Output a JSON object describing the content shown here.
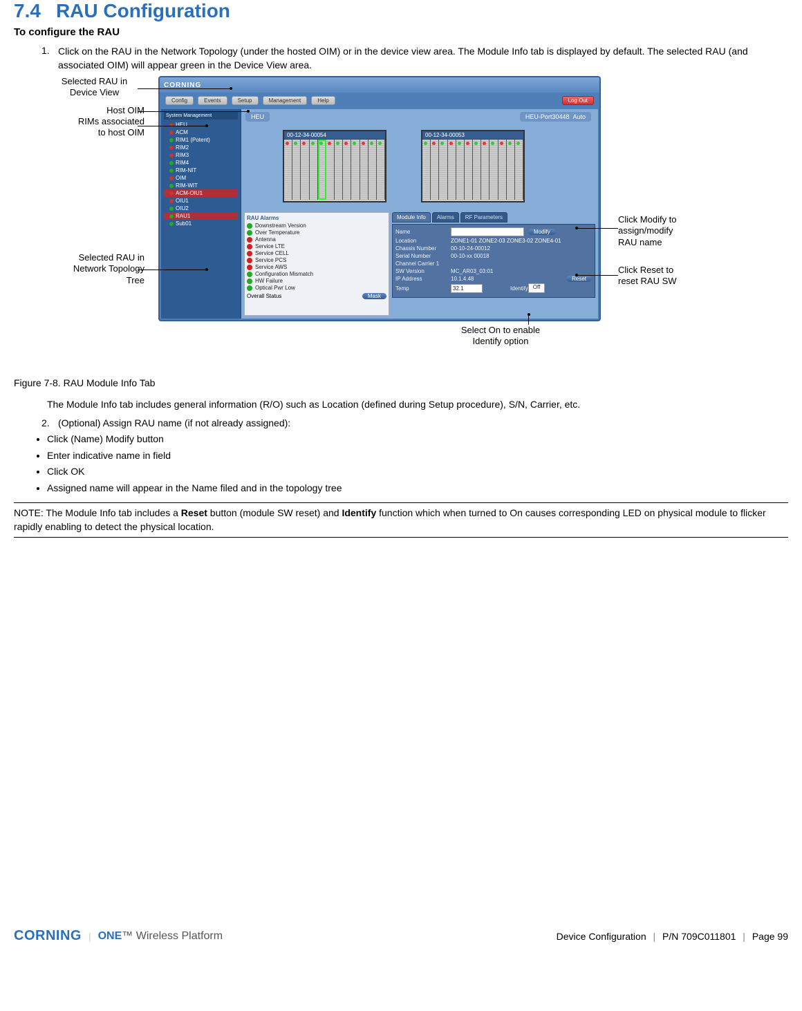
{
  "heading": {
    "number": "7.4",
    "title": "RAU Configuration"
  },
  "subheading": "To configure the RAU",
  "step1_num": "1.",
  "step1": "Click on the RAU in the Network Topology (under the hosted OIM) or in the device view area. The Module Info tab is displayed by default. The selected RAU (and associated OIM) will appear green in the Device View area.",
  "figure_caption": "Figure 7-8. RAU Module Info Tab",
  "module_info_para": "The Module Info tab includes general information (R/O) such as Location (defined during Setup procedure), S/N, Carrier, etc.",
  "step2_num": "2.",
  "step2": "(Optional) Assign RAU name (if not already assigned):",
  "bullets": [
    "Click (Name) Modify button",
    "Enter indicative name in field",
    "Click OK",
    "Assigned name will appear in the Name filed and in the topology tree"
  ],
  "note_prefix": "NOTE: The Module Info tab includes a ",
  "note_reset": "Reset",
  "note_mid": " button (module SW reset) and ",
  "note_identify": "Identify",
  "note_suffix": " function which when turned to On causes corresponding LED on physical module to flicker rapidly enabling to detect the physical location.",
  "callouts": {
    "c1": "Selected RAU in\nDevice View",
    "c2": "Host OIM",
    "c3": "RIMs associated\nto host OIM",
    "c4": "Selected RAU in\nNetwork Topology\nTree",
    "c5": "Click Modify to\nassign/modify\nRAU name",
    "c6": "Click Reset to\nreset RAU SW",
    "c7": "Select On to enable\nIdentify option"
  },
  "screenshot": {
    "brand": "CORNING",
    "toolbar": [
      "Config",
      "Events",
      "Setup",
      "Management",
      "Help"
    ],
    "logout": "Log Out",
    "tree_title": "System Management",
    "tree": [
      {
        "label": "HEU",
        "dot": "r"
      },
      {
        "label": "ACM",
        "dot": "r",
        "sub": false
      },
      {
        "label": "RIM1 (Potent)",
        "dot": "g"
      },
      {
        "label": "RIM2",
        "dot": "r"
      },
      {
        "label": "RIM3",
        "dot": "r"
      },
      {
        "label": "RIM4",
        "dot": "g"
      },
      {
        "label": "RIM-NIT",
        "dot": "g"
      },
      {
        "label": "OIM",
        "dot": "r"
      },
      {
        "label": "RIM-WIT",
        "dot": "g"
      },
      {
        "label": "ACM-OIU1",
        "dot": "r",
        "sel": true
      },
      {
        "label": "OIU1",
        "dot": "r"
      },
      {
        "label": "OIU2",
        "dot": "g"
      },
      {
        "label": "RAU1",
        "dot": "g",
        "sel": true
      },
      {
        "label": "Sub01",
        "dot": "g"
      }
    ],
    "dv_title": "HEU",
    "dv_ip": "HEU-Port30448",
    "dv_auto": "Auto",
    "rack1_label": "00-12-34-00054",
    "rack2_label": "00-12-34-00053",
    "alarms_header": "RAU Alarms",
    "alarms": [
      {
        "c": "g",
        "t": "Downstream Version"
      },
      {
        "c": "g",
        "t": "Over Temperature"
      },
      {
        "c": "r",
        "t": "Antenna"
      },
      {
        "c": "r",
        "t": "Service LTE"
      },
      {
        "c": "r",
        "t": "Service CELL"
      },
      {
        "c": "r",
        "t": "Service PCS"
      },
      {
        "c": "r",
        "t": "Service AWS"
      },
      {
        "c": "g",
        "t": "Configuration Mismatch"
      },
      {
        "c": "g",
        "t": "HW Failure"
      },
      {
        "c": "g",
        "t": "Optical Pwr Low"
      }
    ],
    "overall_label": "Overall Status",
    "overall_btn": "Mask",
    "tabs": [
      "Module Info",
      "Alarms",
      "RF Parameters"
    ],
    "info_rows": {
      "name_label": "Name",
      "name_value": "",
      "modify_btn": "Modify",
      "location_label": "Location",
      "location_value": "ZONE1-01 ZONE2-03 ZONE3-02 ZONE4-01",
      "cs_label": "Chassis Number",
      "cs_value": "00-10-24-00012",
      "sn_label": "Serial Number",
      "sn_value": "00-10-xx 00018",
      "cc_label": "Channel Carrier 1",
      "cc_value": "",
      "sw_label": "SW Version",
      "sw_value": "MC_AR03_03:01",
      "ip_label": "IP Address",
      "ip_value": "10.1.4.48",
      "temp_label": "Temp",
      "temp_value": "32.1",
      "identify_label": "Identify",
      "identify_value": "Off",
      "reset_btn": "Reset"
    }
  },
  "footer": {
    "brand": "CORNING",
    "product_one": "ONE",
    "product_tm": "™",
    "product_rest": " Wireless Platform",
    "section": "Device Configuration",
    "pn": "P/N 709C011801",
    "page": "Page 99"
  }
}
